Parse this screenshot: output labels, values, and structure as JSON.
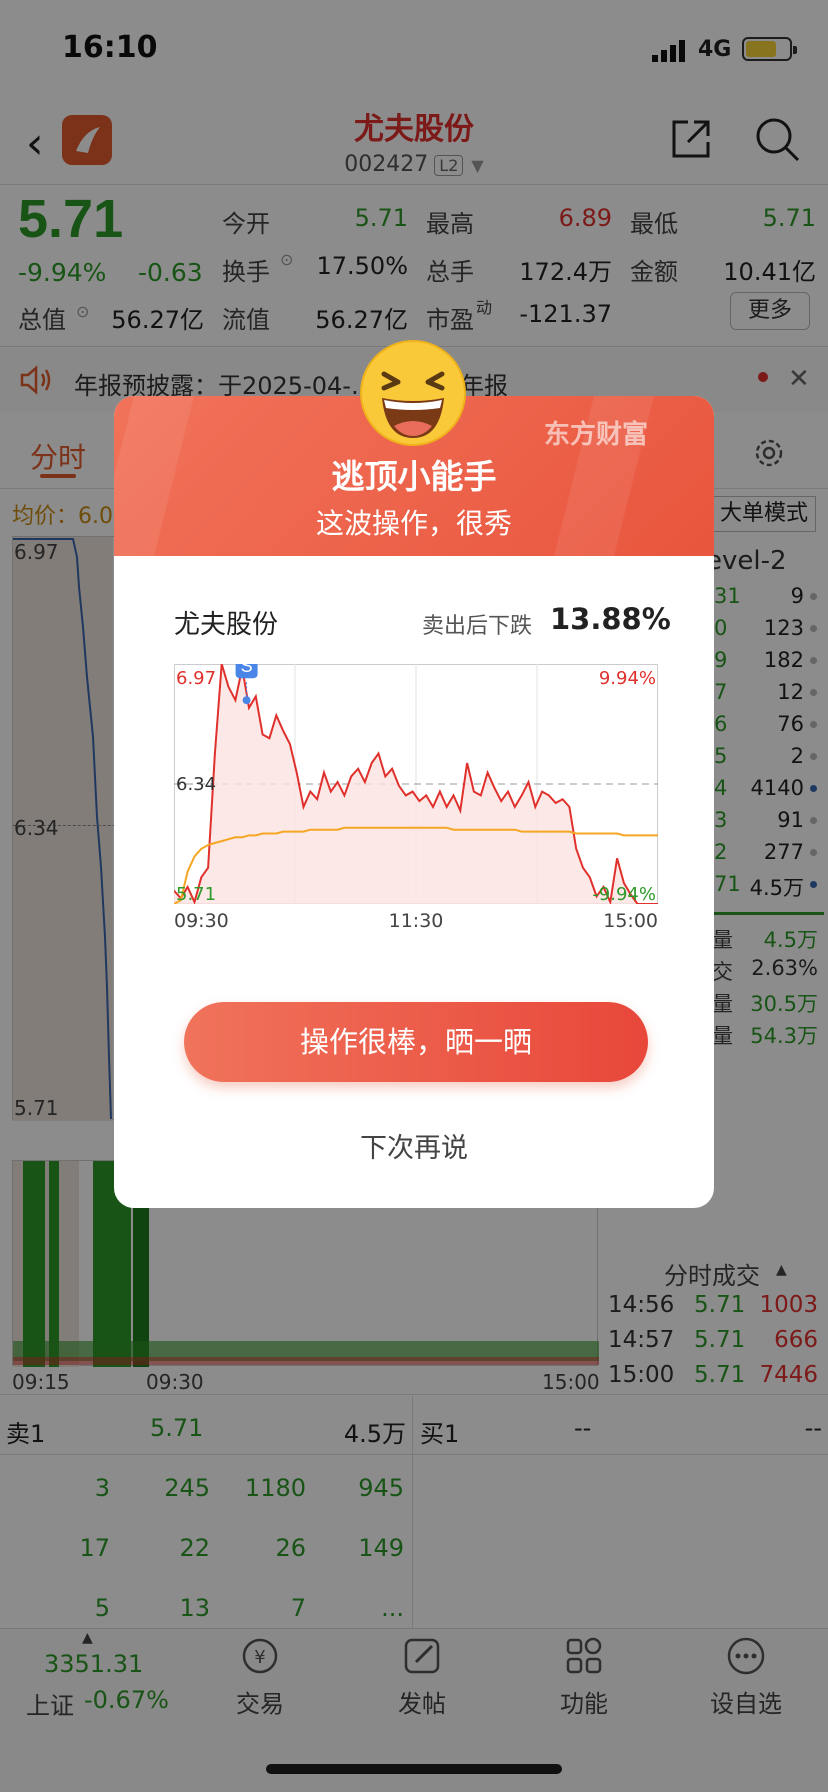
{
  "status": {
    "time": "16:10",
    "network": "4G"
  },
  "header": {
    "title": "尤夫股份",
    "code": "002427",
    "level_badge": "L2"
  },
  "quote": {
    "price": "5.71",
    "change_pct": "-9.94%",
    "change": "-0.63",
    "total_value_label": "总值",
    "total_value": "56.27亿",
    "fields": [
      {
        "label": "今开",
        "value": "5.71"
      },
      {
        "label": "最高",
        "value": "6.89"
      },
      {
        "label": "最低",
        "value": "5.71"
      },
      {
        "label": "换手",
        "value": "17.50%"
      },
      {
        "label": "总手",
        "value": "172.4万"
      },
      {
        "label": "金额",
        "value": "10.41亿"
      },
      {
        "label": "流值",
        "value": "56.27亿"
      },
      {
        "label": "市盈",
        "value": "-121.37"
      }
    ],
    "pe_suffix": "动",
    "more_button": "更多"
  },
  "notice": {
    "text": "年报预披露：于2025-04-…2024年年报"
  },
  "tabs": {
    "active": "分时"
  },
  "intraday": {
    "avg_label": "均价：6.0",
    "mode_button": "大单模式",
    "level2_label": "evel-2",
    "high_label": "6.97",
    "mid_label": "6.34",
    "low_label": "5.71",
    "time_labels": [
      "09:15",
      "09:30",
      "15:00"
    ]
  },
  "orderbook": [
    {
      "p": "31",
      "v": "9"
    },
    {
      "p": "0",
      "v": "123"
    },
    {
      "p": "9",
      "v": "182"
    },
    {
      "p": "7",
      "v": "12"
    },
    {
      "p": "6",
      "v": "76"
    },
    {
      "p": "5",
      "v": "2"
    },
    {
      "p": "4",
      "v": "4140"
    },
    {
      "p": "3",
      "v": "91"
    },
    {
      "p": "2",
      "v": "277"
    },
    {
      "p": "71",
      "v": "4.5万"
    }
  ],
  "stats": [
    {
      "label": "量",
      "value": "4.5万"
    },
    {
      "label": "交",
      "value": "2.63%"
    },
    {
      "label": "量",
      "value": "30.5万"
    },
    {
      "label": "量",
      "value": "54.3万"
    }
  ],
  "ticks": {
    "title": "分时成交",
    "rows": [
      {
        "t": "14:56",
        "p": "5.71",
        "v": "1003"
      },
      {
        "t": "14:57",
        "p": "5.71",
        "v": "666"
      },
      {
        "t": "15:00",
        "p": "5.71",
        "v": "7446"
      }
    ]
  },
  "bidask": {
    "sell_label": "卖1",
    "sell_price": "5.71",
    "sell_vol": "4.5万",
    "buy_label": "买1",
    "buy_price": "--",
    "buy_vol": "--",
    "queue": [
      [
        "3",
        "245",
        "1180",
        "945"
      ],
      [
        "17",
        "22",
        "26",
        "149"
      ],
      [
        "5",
        "13",
        "7",
        "..."
      ]
    ]
  },
  "tabbar": {
    "index_value": "3351.31",
    "index_name": "上证",
    "index_change": "-0.67%",
    "items": [
      "交易",
      "发帖",
      "功能",
      "设自选"
    ]
  },
  "modal": {
    "brand": "东方财富",
    "title": "逃顶小能手",
    "subtitle": "这波操作，很秀",
    "stock_name": "尤夫股份",
    "drop_label": "卖出后下跌",
    "drop_value": "13.88%",
    "share_button": "操作很棒，晒一晒",
    "later_button": "下次再说",
    "colors": {
      "accent": "#e9553d",
      "up": "#e0302c",
      "down": "#2e9a2a",
      "avg_line": "#f5a623"
    }
  },
  "chart_data": {
    "type": "line",
    "title": "",
    "x_ticks": [
      "09:30",
      "11:30",
      "15:00"
    ],
    "y_ticks": [
      "6.97",
      "6.34",
      "5.71"
    ],
    "right_ticks": [
      "9.94%",
      "-9.94%"
    ],
    "ylim": [
      5.71,
      6.97
    ],
    "reference": 6.34,
    "sell_marker": {
      "label": "S",
      "x": 0.15,
      "price": 6.78
    },
    "series": [
      {
        "values": [
          5.78,
          5.74,
          5.8,
          5.72,
          5.85,
          5.9,
          6.5,
          6.97,
          6.85,
          6.78,
          6.95,
          6.74,
          6.8,
          6.6,
          6.58,
          6.7,
          6.62,
          6.55,
          6.4,
          6.22,
          6.3,
          6.26,
          6.4,
          6.3,
          6.35,
          6.28,
          6.38,
          6.42,
          6.35,
          6.45,
          6.5,
          6.38,
          6.42,
          6.33,
          6.28,
          6.3,
          6.25,
          6.28,
          6.22,
          6.3,
          6.22,
          6.28,
          6.2,
          6.45,
          6.3,
          6.28,
          6.4,
          6.32,
          6.25,
          6.3,
          6.22,
          6.28,
          6.35,
          6.22,
          6.3,
          6.28,
          6.24,
          6.26,
          6.22,
          6.0,
          5.9,
          5.85,
          5.75,
          5.8,
          5.72,
          5.95,
          5.82,
          5.76,
          5.71,
          5.71,
          5.71,
          5.71
        ]
      },
      {
        "values": [
          5.71,
          5.73,
          5.88,
          5.96,
          6.0,
          6.02,
          6.03,
          6.04,
          6.05,
          6.06,
          6.06,
          6.07,
          6.07,
          6.08,
          6.08,
          6.08,
          6.09,
          6.09,
          6.09,
          6.09,
          6.1,
          6.1,
          6.1,
          6.1,
          6.1,
          6.11,
          6.11,
          6.11,
          6.11,
          6.11,
          6.11,
          6.11,
          6.11,
          6.11,
          6.11,
          6.11,
          6.11,
          6.11,
          6.11,
          6.11,
          6.11,
          6.1,
          6.1,
          6.1,
          6.1,
          6.1,
          6.1,
          6.1,
          6.1,
          6.1,
          6.1,
          6.09,
          6.09,
          6.09,
          6.09,
          6.09,
          6.09,
          6.09,
          6.09,
          6.08,
          6.08,
          6.08,
          6.08,
          6.08,
          6.08,
          6.08,
          6.07,
          6.07,
          6.07,
          6.07,
          6.07,
          6.07
        ]
      }
    ]
  }
}
